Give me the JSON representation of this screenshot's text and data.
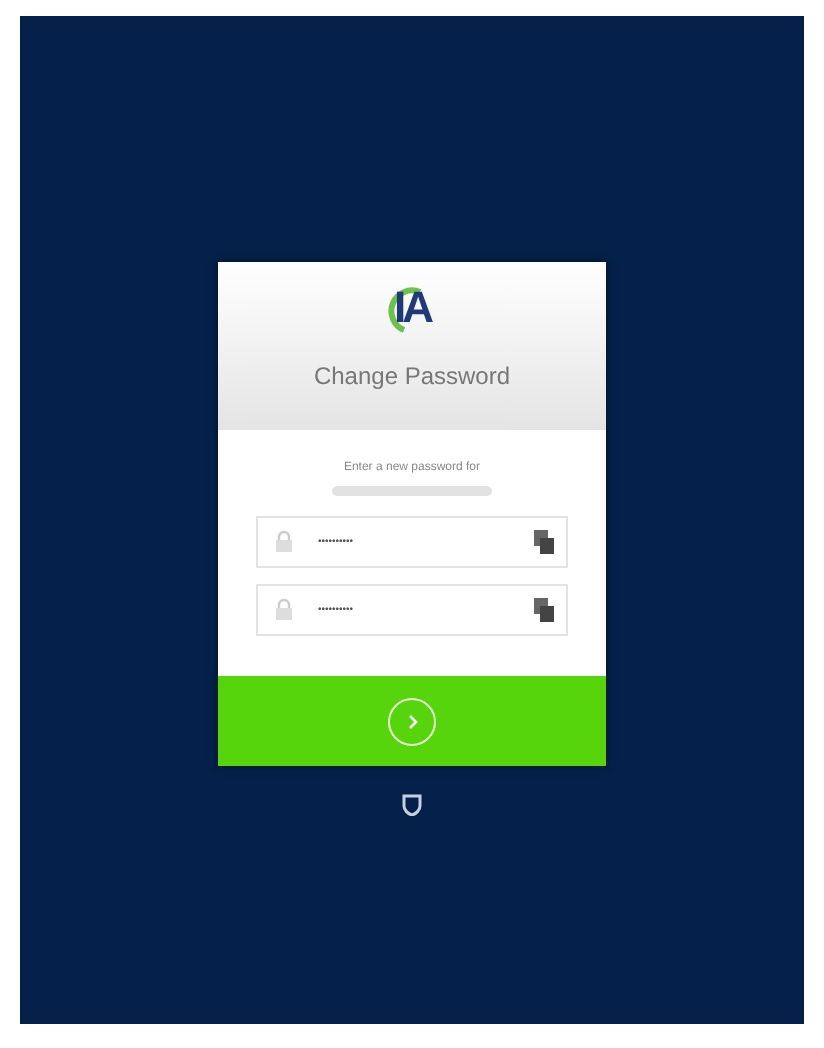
{
  "logo": {
    "text": "IA"
  },
  "title": "Change Password",
  "prompt": "Enter a new password for",
  "fields": [
    {
      "value": "••••••••••"
    },
    {
      "value": "••••••••••"
    }
  ]
}
